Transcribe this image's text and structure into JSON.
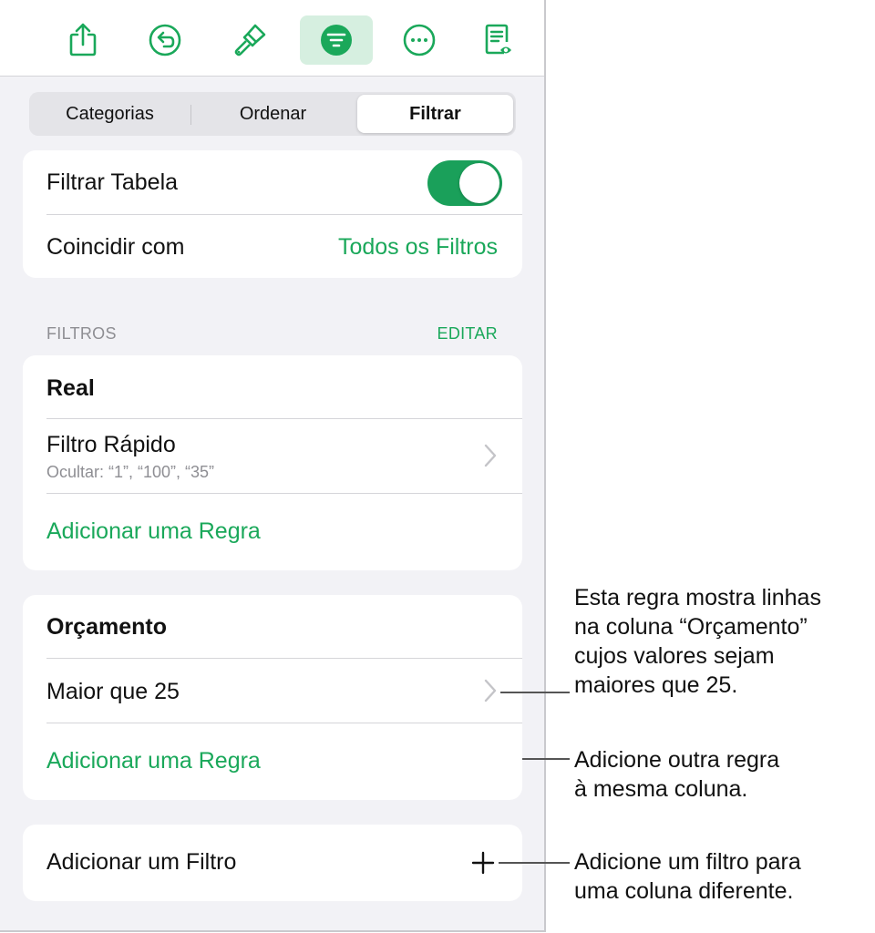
{
  "toolbar": {
    "buttons": [
      {
        "icon": "share-icon"
      },
      {
        "icon": "undo-icon"
      },
      {
        "icon": "format-brush-icon"
      },
      {
        "icon": "organize-filter-icon",
        "active": true
      },
      {
        "icon": "more-icon"
      },
      {
        "icon": "reader-view-icon"
      }
    ]
  },
  "segments": {
    "items": [
      "Categorias",
      "Ordenar",
      "Filtrar"
    ],
    "selected": "Filtrar"
  },
  "filter_table": {
    "label": "Filtrar Tabela",
    "toggle_on": true
  },
  "match": {
    "label": "Coincidir com",
    "value": "Todos os Filtros"
  },
  "filters_section": {
    "title": "FILTROS",
    "edit": "EDITAR"
  },
  "filters": [
    {
      "column": "Real",
      "rule_title": "Filtro Rápido",
      "rule_subtitle": "Ocultar: “1”, “100”, “35”",
      "add_rule": "Adicionar uma Regra"
    },
    {
      "column": "Orçamento",
      "rule_title": "Maior que 25",
      "add_rule": "Adicionar uma Regra"
    }
  ],
  "add_filter": {
    "label": "Adicionar um Filtro",
    "icon": "plus-icon"
  },
  "callouts": {
    "rule": [
      "Esta regra mostra linhas",
      "na coluna “Orçamento”",
      "cujos valores sejam",
      "maiores que 25."
    ],
    "add_rule": [
      "Adicione outra regra",
      "à mesma coluna."
    ],
    "add_filter": [
      "Adicione um filtro para",
      "uma coluna diferente."
    ]
  },
  "colors": {
    "accent": "#1aa85a",
    "toggle": "#1aa05a",
    "active_tab_bg": "#d6efe0",
    "panel_bg": "#f2f2f6"
  }
}
